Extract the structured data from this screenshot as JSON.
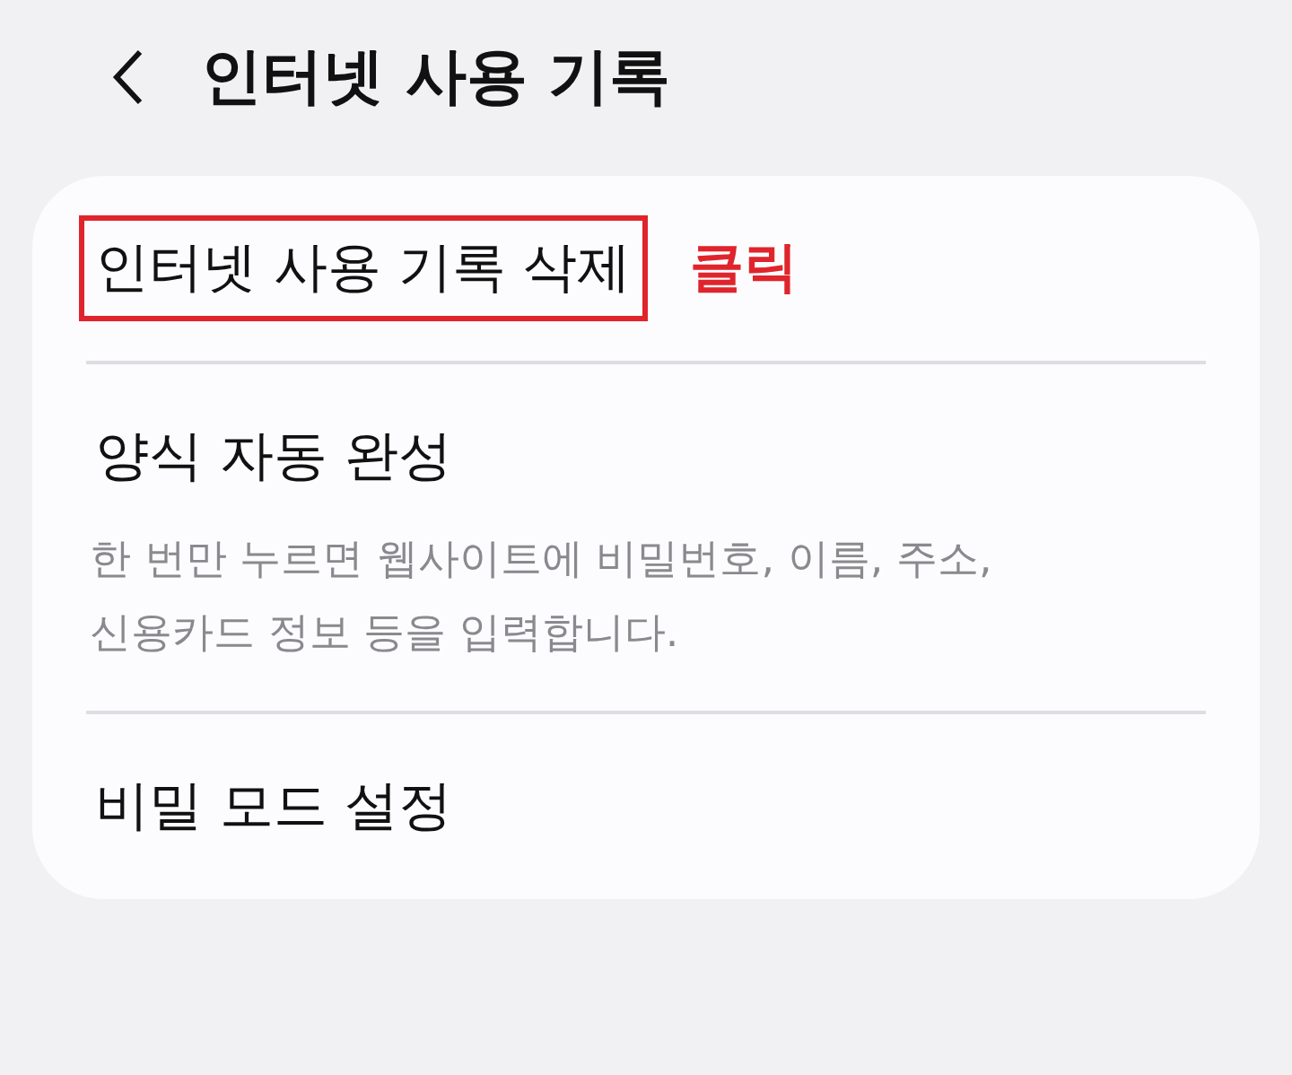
{
  "header": {
    "title": "인터넷 사용 기록"
  },
  "items": [
    {
      "title": "인터넷 사용 기록 삭제",
      "highlighted": true,
      "annotation": "클릭"
    },
    {
      "title": "양식 자동 완성",
      "highlighted": false,
      "description": "한 번만 누르면 웹사이트에 비밀번호, 이름, 주소,\n신용카드 정보 등을 입력합니다."
    },
    {
      "title": "비밀 모드 설정",
      "highlighted": false
    }
  ]
}
